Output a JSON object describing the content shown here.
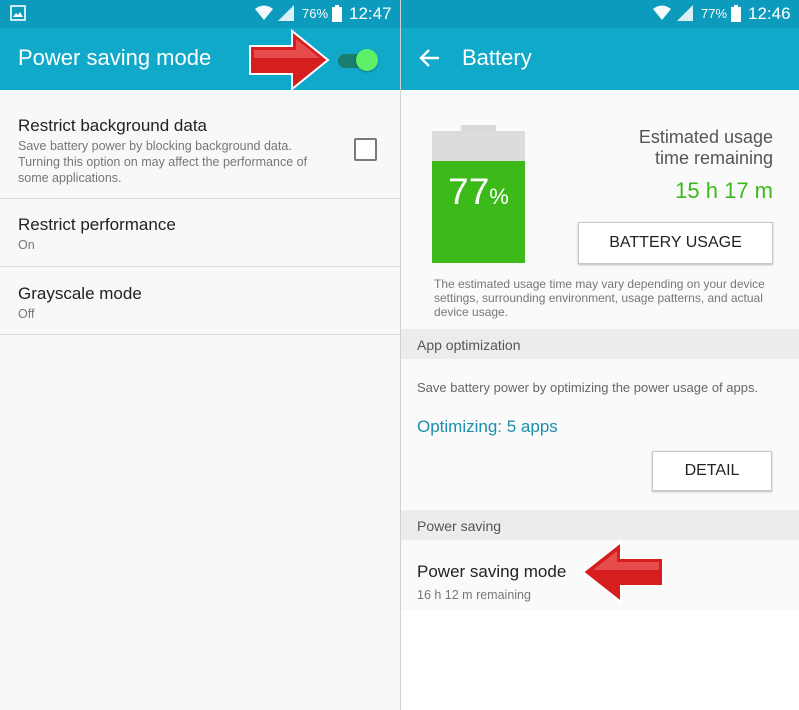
{
  "left": {
    "status": {
      "battery_percent": "76%",
      "time": "12:47"
    },
    "title": "Power saving mode",
    "toggle_on": true,
    "items": [
      {
        "title": "Restrict background data",
        "subtitle_lines": [
          "Save battery power by blocking background data.",
          "Turning this option on may affect the performance of",
          "some applications."
        ],
        "checked": false
      },
      {
        "title": "Restrict performance",
        "subtitle": "On"
      },
      {
        "title": "Grayscale mode",
        "subtitle": "Off"
      }
    ]
  },
  "right": {
    "status": {
      "battery_percent": "77%",
      "time": "12:46"
    },
    "title": "Battery",
    "battery_level_number": "77",
    "battery_level_unit": "%",
    "battery_level_fraction": 0.77,
    "estimated_label_lines": [
      "Estimated usage",
      "time remaining"
    ],
    "estimated_time": "15 h 17 m",
    "battery_usage_button": "BATTERY USAGE",
    "disclaimer_lines": [
      "The estimated usage time may vary depending on your device",
      "settings, surrounding environment, usage patterns, and actual",
      "device usage."
    ],
    "app_optimization": {
      "header": "App optimization",
      "description": "Save battery power by optimizing the power usage of apps.",
      "optimizing": "Optimizing: 5 apps",
      "detail_button": "DETAIL"
    },
    "power_saving": {
      "header": "Power saving",
      "title": "Power saving mode",
      "subtitle": "16 h 12 m remaining"
    }
  },
  "colors": {
    "appbar": "#11a9c9",
    "statusbar": "#0c9bbc",
    "battery_green": "#3cba1a",
    "accent_teal": "#1a8fae",
    "toggle_thumb": "#5ff06a",
    "toggle_track": "#1a7d6e",
    "arrow_red": "#d61e1e"
  }
}
